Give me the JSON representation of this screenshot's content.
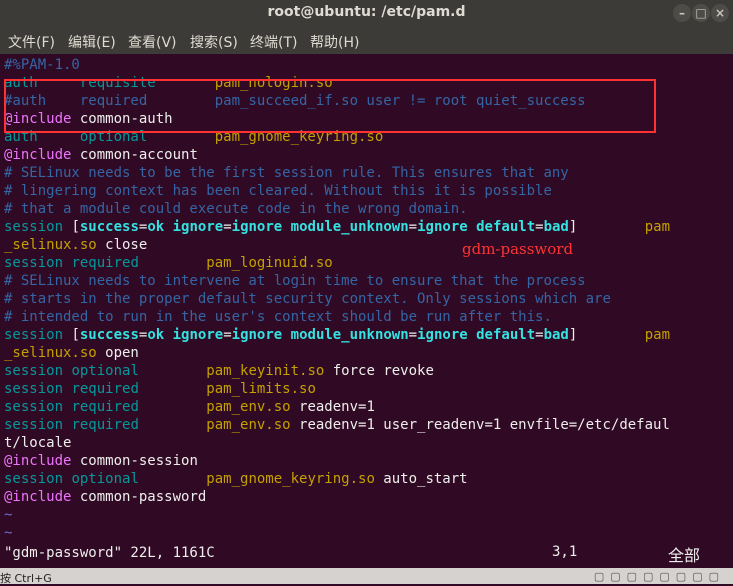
{
  "window": {
    "title": "root@ubuntu: /etc/pam.d"
  },
  "menu": [
    "文件(F)",
    "编辑(E)",
    "查看(V)",
    "搜索(S)",
    "终端(T)",
    "帮助(H)"
  ],
  "editor": {
    "lines": [
      [
        {
          "t": "#%PAM-1.0",
          "c": "cmt"
        }
      ],
      [
        {
          "t": "auth     ",
          "c": "kw"
        },
        {
          "t": "requisite       ",
          "c": "kw"
        },
        {
          "t": "pam_nologin.so",
          "c": "mod"
        }
      ],
      [
        {
          "t": "#auth    required        pam_succeed_if.so user != root quiet_success",
          "c": "cmt"
        }
      ],
      [
        {
          "t": "@include",
          "c": "inc"
        },
        {
          "t": " common-auth",
          "c": ""
        }
      ],
      [
        {
          "t": "auth     ",
          "c": "kw"
        },
        {
          "t": "optional        ",
          "c": "kw"
        },
        {
          "t": "pam_gnome_keyring.so",
          "c": "mod"
        }
      ],
      [
        {
          "t": "@include",
          "c": "inc"
        },
        {
          "t": " common-account",
          "c": ""
        }
      ],
      [
        {
          "t": "# SELinux needs to be the first session rule. This ensures that any",
          "c": "cmt"
        }
      ],
      [
        {
          "t": "# lingering context has been cleared. Without this it is possible",
          "c": "cmt"
        }
      ],
      [
        {
          "t": "# that a module could execute code in the wrong domain.",
          "c": "cmt"
        }
      ],
      [
        {
          "t": "session ",
          "c": "kw"
        },
        {
          "t": "[",
          "c": ""
        },
        {
          "t": "success",
          "c": "bool"
        },
        {
          "t": "=",
          "c": ""
        },
        {
          "t": "ok",
          "c": "bool"
        },
        {
          "t": " ",
          "c": ""
        },
        {
          "t": "ignore",
          "c": "bool"
        },
        {
          "t": "=",
          "c": ""
        },
        {
          "t": "ignore",
          "c": "bool"
        },
        {
          "t": " ",
          "c": ""
        },
        {
          "t": "module_unknown",
          "c": "bool"
        },
        {
          "t": "=",
          "c": ""
        },
        {
          "t": "ignore",
          "c": "bool"
        },
        {
          "t": " ",
          "c": ""
        },
        {
          "t": "default",
          "c": "bool"
        },
        {
          "t": "=",
          "c": ""
        },
        {
          "t": "bad",
          "c": "bool"
        },
        {
          "t": "]        ",
          "c": ""
        },
        {
          "t": "pam",
          "c": "mod"
        }
      ],
      [
        {
          "t": "_selinux.so",
          "c": "mod"
        },
        {
          "t": " close",
          "c": ""
        }
      ],
      [
        {
          "t": "session ",
          "c": "kw"
        },
        {
          "t": "required        ",
          "c": "kw"
        },
        {
          "t": "pam_loginuid.so",
          "c": "mod"
        }
      ],
      [
        {
          "t": "# SELinux needs to intervene at login time to ensure that the process",
          "c": "cmt"
        }
      ],
      [
        {
          "t": "# starts in the proper default security context. Only sessions which are",
          "c": "cmt"
        }
      ],
      [
        {
          "t": "# intended to run in the user's context should be run after this.",
          "c": "cmt"
        }
      ],
      [
        {
          "t": "session ",
          "c": "kw"
        },
        {
          "t": "[",
          "c": ""
        },
        {
          "t": "success",
          "c": "bool"
        },
        {
          "t": "=",
          "c": ""
        },
        {
          "t": "ok",
          "c": "bool"
        },
        {
          "t": " ",
          "c": ""
        },
        {
          "t": "ignore",
          "c": "bool"
        },
        {
          "t": "=",
          "c": ""
        },
        {
          "t": "ignore",
          "c": "bool"
        },
        {
          "t": " ",
          "c": ""
        },
        {
          "t": "module_unknown",
          "c": "bool"
        },
        {
          "t": "=",
          "c": ""
        },
        {
          "t": "ignore",
          "c": "bool"
        },
        {
          "t": " ",
          "c": ""
        },
        {
          "t": "default",
          "c": "bool"
        },
        {
          "t": "=",
          "c": ""
        },
        {
          "t": "bad",
          "c": "bool"
        },
        {
          "t": "]        ",
          "c": ""
        },
        {
          "t": "pam",
          "c": "mod"
        }
      ],
      [
        {
          "t": "_selinux.so",
          "c": "mod"
        },
        {
          "t": " open",
          "c": ""
        }
      ],
      [
        {
          "t": "session ",
          "c": "kw"
        },
        {
          "t": "optional        ",
          "c": "kw"
        },
        {
          "t": "pam_keyinit.so",
          "c": "mod"
        },
        {
          "t": " force revoke",
          "c": ""
        }
      ],
      [
        {
          "t": "session ",
          "c": "kw"
        },
        {
          "t": "required        ",
          "c": "kw"
        },
        {
          "t": "pam_limits.so",
          "c": "mod"
        }
      ],
      [
        {
          "t": "session ",
          "c": "kw"
        },
        {
          "t": "required        ",
          "c": "kw"
        },
        {
          "t": "pam_env.so",
          "c": "mod"
        },
        {
          "t": " readenv=1",
          "c": ""
        }
      ],
      [
        {
          "t": "session ",
          "c": "kw"
        },
        {
          "t": "required        ",
          "c": "kw"
        },
        {
          "t": "pam_env.so",
          "c": "mod"
        },
        {
          "t": " readenv=1 user_readenv=1 envfile=/etc/defaul",
          "c": ""
        }
      ],
      [
        {
          "t": "t/locale",
          "c": ""
        }
      ],
      [
        {
          "t": "@include",
          "c": "inc"
        },
        {
          "t": " common-session",
          "c": ""
        }
      ],
      [
        {
          "t": "session ",
          "c": "kw"
        },
        {
          "t": "optional        ",
          "c": "kw"
        },
        {
          "t": "pam_gnome_keyring.so",
          "c": "mod"
        },
        {
          "t": " auto_start",
          "c": ""
        }
      ],
      [
        {
          "t": "@include",
          "c": "inc"
        },
        {
          "t": " common-password",
          "c": ""
        }
      ],
      [
        {
          "t": "~",
          "c": "tilde"
        }
      ],
      [
        {
          "t": "~",
          "c": "tilde"
        }
      ]
    ]
  },
  "annotation": "gdm-password",
  "status": {
    "file_info": "\"gdm-password\" 22L, 1161C",
    "cursor_pos": "3,1",
    "scroll": "全部"
  },
  "vm_bar": {
    "hint": "按 Ctrl+G"
  },
  "colors": {
    "background": "#300a24",
    "highlight_box": "#ff3131",
    "annotation": "#ff3333"
  }
}
